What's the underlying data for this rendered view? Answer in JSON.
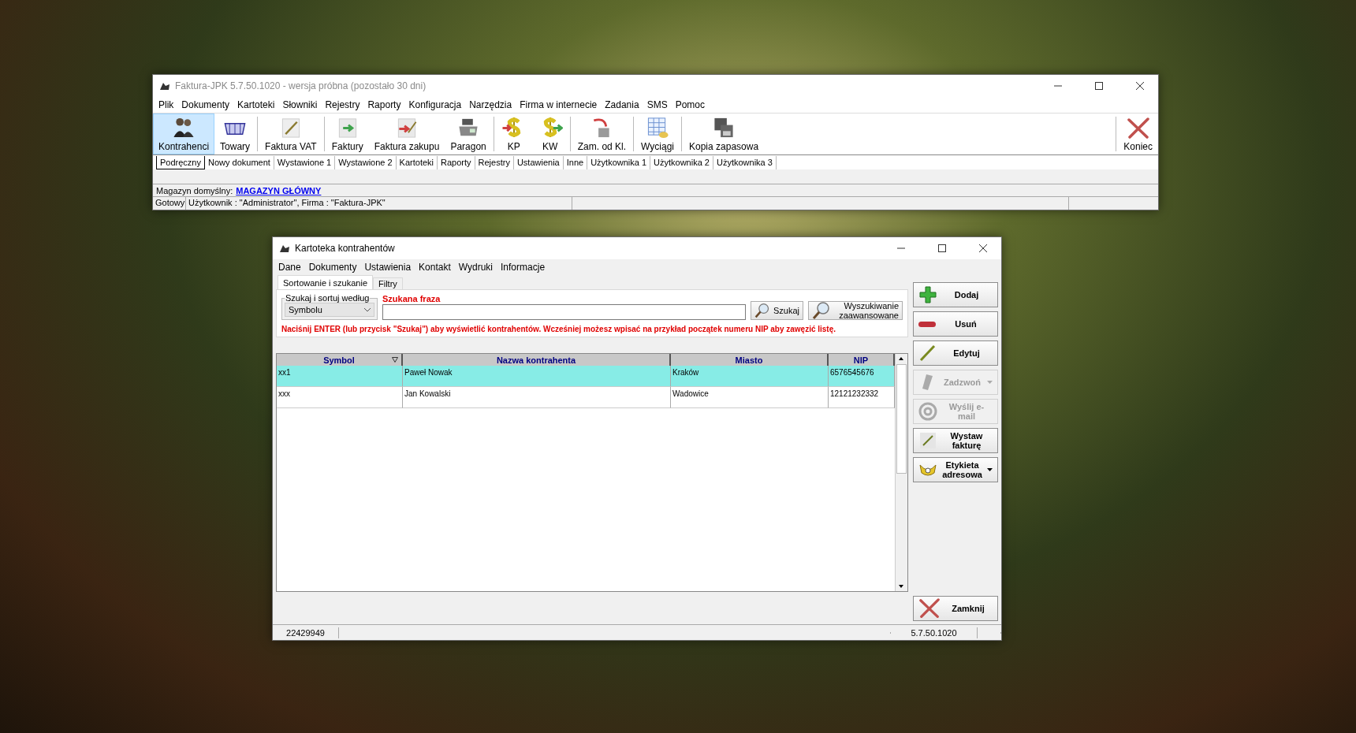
{
  "main_window": {
    "title": "Faktura-JPK 5.7.50.1020 - wersja próbna (pozostało 30 dni)",
    "menu": [
      {
        "label": "Plik"
      },
      {
        "label": "Dokumenty"
      },
      {
        "label": "Kartoteki"
      },
      {
        "label": "Słowniki"
      },
      {
        "label": "Rejestry"
      },
      {
        "label": "Raporty"
      },
      {
        "label": "Konfiguracja"
      },
      {
        "label": "Narzędzia"
      },
      {
        "label": "Firma w internecie"
      },
      {
        "label": "Zadania"
      },
      {
        "label": "SMS"
      },
      {
        "label": "Pomoc"
      }
    ],
    "toolbar": [
      {
        "label": "Kontrahenci",
        "selected": true,
        "separator_after": false
      },
      {
        "label": "Towary",
        "selected": false,
        "separator_after": true
      },
      {
        "label": "Faktura VAT",
        "selected": false,
        "separator_after": true
      },
      {
        "label": "Faktury",
        "selected": false,
        "separator_after": false
      },
      {
        "label": "Faktura zakupu",
        "selected": false,
        "separator_after": false
      },
      {
        "label": "Paragon",
        "selected": false,
        "separator_after": true
      },
      {
        "label": "KP",
        "selected": false,
        "separator_after": false
      },
      {
        "label": "KW",
        "selected": false,
        "separator_after": true
      },
      {
        "label": "Zam. od Kl.",
        "selected": false,
        "separator_after": true
      },
      {
        "label": "Wyciągi",
        "selected": false,
        "separator_after": true
      },
      {
        "label": "Kopia zapasowa",
        "selected": false,
        "separator_after": false
      }
    ],
    "exit_button": {
      "label": "Koniec"
    },
    "quick_tabs": [
      {
        "label": "Podręczny",
        "selected": true
      },
      {
        "label": "Nowy dokument",
        "selected": false
      },
      {
        "label": "Wystawione 1",
        "selected": false
      },
      {
        "label": "Wystawione 2",
        "selected": false
      },
      {
        "label": "Kartoteki",
        "selected": false
      },
      {
        "label": "Raporty",
        "selected": false
      },
      {
        "label": "Rejestry",
        "selected": false
      },
      {
        "label": "Ustawienia",
        "selected": false
      },
      {
        "label": "Inne",
        "selected": false
      },
      {
        "label": "Użytkownika 1",
        "selected": false
      },
      {
        "label": "Użytkownika 2",
        "selected": false
      },
      {
        "label": "Użytkownika 3",
        "selected": false
      }
    ],
    "warehouse": {
      "label": "Magazyn domyślny:",
      "value": "MAGAZYN GŁÓWNY"
    },
    "status_bar": [
      "Gotowy",
      "Użytkownik : \"Administrator\", Firma : \"Faktura-JPK\""
    ]
  },
  "dialog": {
    "title": "Kartoteka kontrahentów",
    "menu": [
      {
        "label": "Dane"
      },
      {
        "label": "Dokumenty"
      },
      {
        "label": "Ustawienia"
      },
      {
        "label": "Kontakt"
      },
      {
        "label": "Wydruki"
      },
      {
        "label": "Informacje"
      }
    ],
    "tabs": [
      {
        "label": "Sortowanie i szukanie",
        "selected": true
      },
      {
        "label": "Filtry",
        "selected": false
      }
    ],
    "sort_group": {
      "label": "Szukaj i sortuj według",
      "value": "Symbolu"
    },
    "search": {
      "label": "Szukana fraza"
    },
    "search_button": {
      "label": "Szukaj"
    },
    "advanced_button": {
      "label": "Wyszukiwanie zaawansowane"
    },
    "hint": "Naciśnij ENTER (lub przycisk \"Szukaj\") aby wyświetlić kontrahentów. Wcześniej możesz wpisać na przykład początek numeru NIP aby zawęzić listę.",
    "table": {
      "columns": [
        {
          "label": "Symbol",
          "sorted": true
        },
        {
          "label": "Nazwa kontrahenta",
          "sorted": false
        },
        {
          "label": "Miasto",
          "sorted": false
        },
        {
          "label": "NIP",
          "sorted": false
        }
      ],
      "rows": [
        {
          "cells": [
            "xx1",
            "Paweł Nowak",
            "Kraków",
            "6576545676"
          ],
          "selected": true
        },
        {
          "cells": [
            "xxx",
            "Jan Kowalski",
            "Wadowice",
            "12121232332"
          ],
          "selected": false
        }
      ]
    },
    "side_buttons": [
      {
        "kind": "add",
        "label": "Dodaj",
        "disabled": false,
        "dropdown": false
      },
      {
        "kind": "remove",
        "label": "Usuń",
        "disabled": false,
        "dropdown": false
      },
      {
        "kind": "edit",
        "label": "Edytuj",
        "disabled": false,
        "dropdown": false
      },
      {
        "kind": "call",
        "label": "Zadzwoń",
        "disabled": true,
        "dropdown": true
      },
      {
        "kind": "email",
        "label": "Wyślij e-mail",
        "disabled": true,
        "dropdown": false
      },
      {
        "kind": "invoice",
        "label": "Wystaw fakturę",
        "disabled": false,
        "dropdown": false
      },
      {
        "kind": "label",
        "label": "Etykieta adresowa",
        "disabled": false,
        "dropdown": true
      }
    ],
    "close_button": {
      "label": "Zamknij"
    },
    "status_bar": [
      "22429949",
      "5.7.50.1020"
    ]
  }
}
